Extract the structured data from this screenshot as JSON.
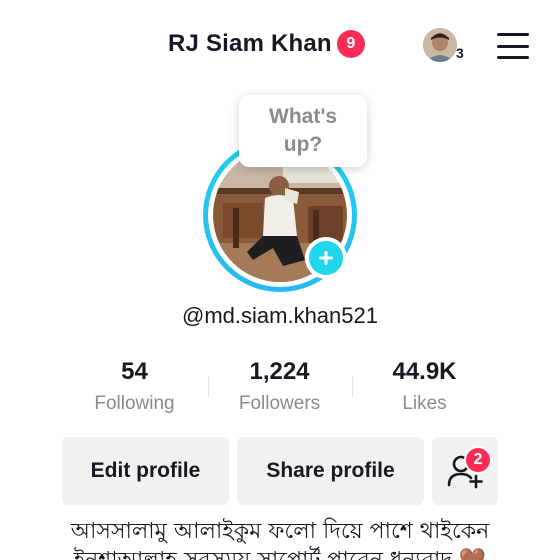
{
  "header": {
    "title": "RJ Siam Khan",
    "notification_count": "9",
    "account_count": "3"
  },
  "story_bubble": {
    "line1": "What's",
    "line2": "up?"
  },
  "profile": {
    "username": "@md.siam.khan521"
  },
  "stats": [
    {
      "value": "54",
      "label": "Following"
    },
    {
      "value": "1,224",
      "label": "Followers"
    },
    {
      "value": "44.9K",
      "label": "Likes"
    }
  ],
  "actions": {
    "edit_profile": "Edit profile",
    "share_profile": "Share profile",
    "add_friends_badge": "2"
  },
  "bio": {
    "line1": "আসসালামু আলাইকুম ফলো দিয়ে পাশে থাইকেন",
    "line2": "ইনশাআল্লাহ সবসময় সাপোর্ট পাবেন ধন্যবাদ 🤎"
  },
  "colors": {
    "accent_cyan": "#20d5ec",
    "badge_red": "#fe2c55",
    "button_bg": "#f1f1f2",
    "muted_text": "#8a8b91"
  }
}
